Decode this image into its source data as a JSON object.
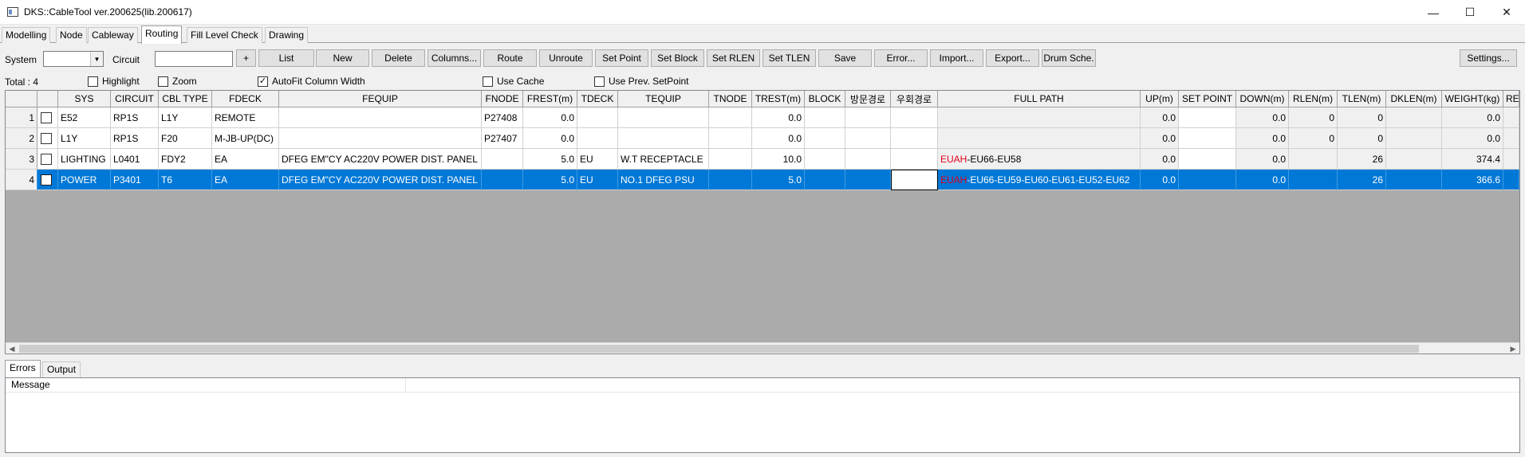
{
  "window": {
    "title": "DKS::CableTool ver.200625(lib.200617)",
    "minimize_glyph": "—",
    "maximize_glyph": "☐",
    "close_glyph": "✕"
  },
  "tabs": [
    "Modelling",
    "Node",
    "Cableway",
    "Routing",
    "Fill Level Check",
    "Drawing"
  ],
  "active_tab": "Routing",
  "toolbar": {
    "system_label": "System",
    "system_value": "",
    "circuit_label": "Circuit",
    "circuit_value": "",
    "buttons": {
      "plus": "+",
      "list": "List",
      "new": "New",
      "delete": "Delete",
      "columns": "Columns...",
      "route": "Route",
      "unroute": "Unroute",
      "set_point": "Set Point",
      "set_block": "Set Block",
      "set_rlen": "Set RLEN",
      "set_tlen": "Set TLEN",
      "save": "Save",
      "error": "Error...",
      "import": "Import...",
      "export": "Export...",
      "drum": "Drum Sche.",
      "settings": "Settings..."
    }
  },
  "options": {
    "total": "Total : 4",
    "highlight": {
      "label": "Highlight",
      "checked": false
    },
    "zoom": {
      "label": "Zoom",
      "checked": false
    },
    "autofit": {
      "label": "AutoFit Column Width",
      "checked": true
    },
    "use_cache": {
      "label": "Use Cache",
      "checked": false
    },
    "use_prev": {
      "label": "Use Prev. SetPoint",
      "checked": false
    }
  },
  "grid": {
    "columns": [
      "SYS",
      "CIRCUIT",
      "CBL TYPE",
      "FDECK",
      "FEQUIP",
      "FNODE",
      "FREST(m)",
      "TDECK",
      "TEQUIP",
      "TNODE",
      "TREST(m)",
      "BLOCK",
      "방문경로",
      "우회경로",
      "FULL PATH",
      "UP(m)",
      "SET POINT",
      "DOWN(m)",
      "RLEN(m)",
      "TLEN(m)",
      "DKLEN(m)",
      "WEIGHT(kg)",
      "RE"
    ],
    "rows": [
      {
        "num": "1",
        "sys": "E52",
        "circuit": "RP1S",
        "cbl_type": "L1Y",
        "fdeck": "REMOTE",
        "fequip": "",
        "fnode": "P27408",
        "frest": "0.0",
        "tdeck": "",
        "tequip": "",
        "tnode": "",
        "trest": "0.0",
        "block": "",
        "visit": "",
        "bypass": "",
        "path_red": "",
        "path_rest": "",
        "up": "0.0",
        "set_point": "",
        "down": "0.0",
        "rlen": "0",
        "tlen": "0",
        "dklen": "",
        "weight": "0.0",
        "re": ""
      },
      {
        "num": "2",
        "sys": "L1Y",
        "circuit": "RP1S",
        "cbl_type": "F20",
        "fdeck": "M-JB-UP(DC)",
        "fequip": "",
        "fnode": "P27407",
        "frest": "0.0",
        "tdeck": "",
        "tequip": "",
        "tnode": "",
        "trest": "0.0",
        "block": "",
        "visit": "",
        "bypass": "",
        "path_red": "",
        "path_rest": "",
        "up": "0.0",
        "set_point": "",
        "down": "0.0",
        "rlen": "0",
        "tlen": "0",
        "dklen": "",
        "weight": "0.0",
        "re": ""
      },
      {
        "num": "3",
        "sys": "LIGHTING",
        "circuit": "L0401",
        "cbl_type": "FDY2",
        "fdeck": "EA",
        "fequip": "DFEG EM\"CY AC220V POWER DIST. PANEL",
        "fnode": "",
        "frest": "5.0",
        "tdeck": "EU",
        "tequip": "W.T RECEPTACLE",
        "tnode": "",
        "trest": "10.0",
        "block": "",
        "visit": "",
        "bypass": "",
        "path_red": "EUAH",
        "path_rest": "-EU66-EU58",
        "up": "0.0",
        "set_point": "",
        "down": "0.0",
        "rlen": "",
        "tlen": "26",
        "dklen": "",
        "weight": "374.4",
        "re": ""
      },
      {
        "num": "4",
        "sys": "POWER",
        "circuit": "P3401",
        "cbl_type": "T6",
        "fdeck": "EA",
        "fequip": "DFEG EM\"CY AC220V POWER DIST. PANEL",
        "fnode": "",
        "frest": "5.0",
        "tdeck": "EU",
        "tequip": "NO.1 DFEG PSU",
        "tnode": "",
        "trest": "5.0",
        "block": "",
        "visit": "",
        "bypass": "",
        "path_red": "EUAH",
        "path_rest": "-EU66-EU59-EU60-EU61-EU52-EU62",
        "up": "0.0",
        "set_point": "",
        "down": "0.0",
        "rlen": "",
        "tlen": "26",
        "dklen": "",
        "weight": "366.6",
        "re": ""
      }
    ],
    "selected_row": 4
  },
  "bottom_tabs": [
    "Errors",
    "Output"
  ],
  "message_panel": {
    "column": "Message"
  }
}
